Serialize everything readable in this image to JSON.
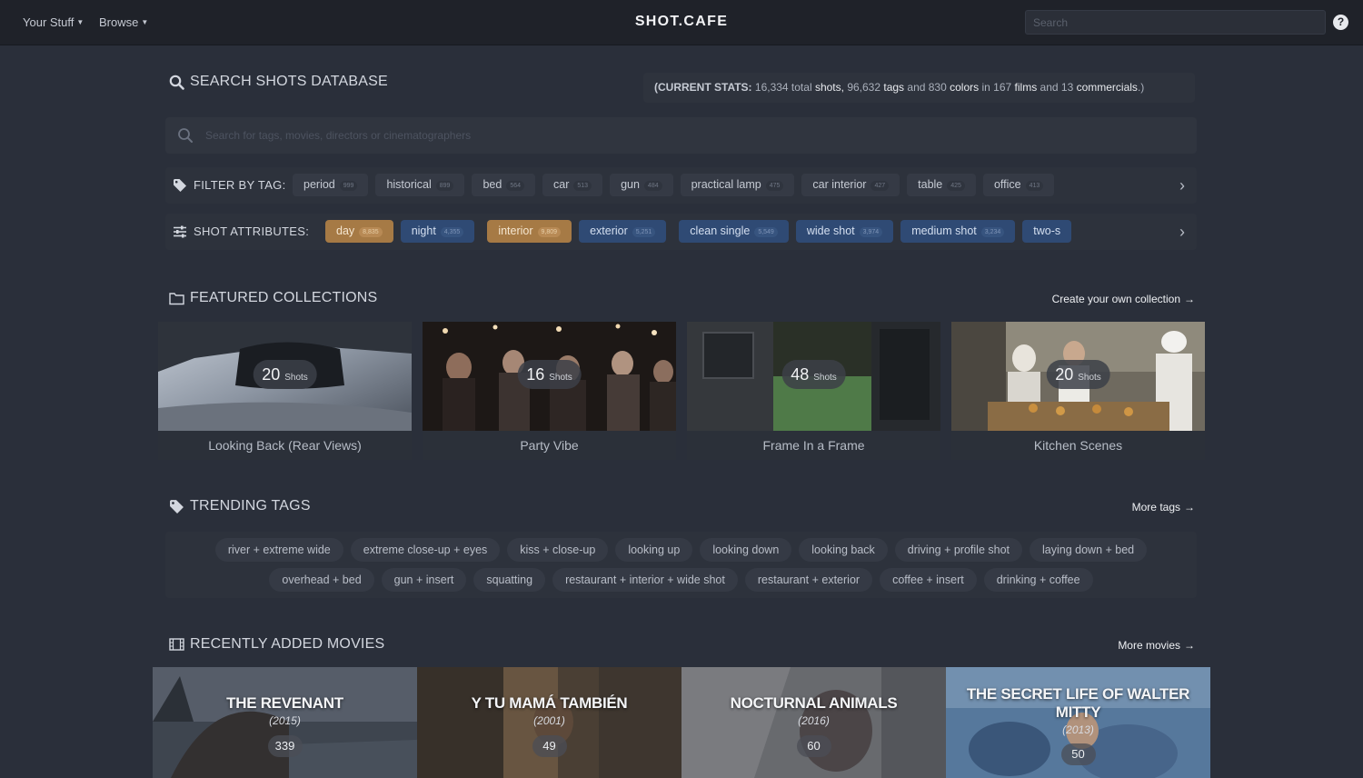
{
  "nav": {
    "your_stuff": "Your Stuff",
    "browse": "Browse",
    "logo": "SHOT.CAFE",
    "search_placeholder": "Search",
    "help": "?"
  },
  "search": {
    "title": "SEARCH SHOTS DATABASE",
    "stats_prefix": "(CURRENT STATS:",
    "stats_shots_n": "16,334 total",
    "stats_shots_w": "shots,",
    "stats_tags_n": "96,632",
    "stats_tags_w": "tags",
    "stats_and1": "and 830",
    "stats_colors_w": "colors",
    "stats_in": "in 167",
    "stats_films_w": "films",
    "stats_and2": "and 13",
    "stats_comm_w": "commercials",
    "stats_suffix": ".)",
    "placeholder": "Search for tags, movies, directors or cinematographers",
    "filter_label": "FILTER BY TAG:",
    "tags": [
      {
        "label": "period",
        "count": "999"
      },
      {
        "label": "historical",
        "count": "899"
      },
      {
        "label": "bed",
        "count": "564"
      },
      {
        "label": "car",
        "count": "513"
      },
      {
        "label": "gun",
        "count": "484"
      },
      {
        "label": "practical lamp",
        "count": "475"
      },
      {
        "label": "car interior",
        "count": "427"
      },
      {
        "label": "table",
        "count": "425"
      },
      {
        "label": "office",
        "count": "413"
      }
    ],
    "attr_label": "SHOT ATTRIBUTES:",
    "attributes": [
      {
        "label": "day",
        "count": "8,835"
      },
      {
        "label": "night",
        "count": "4,355"
      },
      {
        "label": "interior",
        "count": "9,809"
      },
      {
        "label": "exterior",
        "count": "5,251"
      },
      {
        "label": "clean single",
        "count": "5,549"
      },
      {
        "label": "wide shot",
        "count": "3,974"
      },
      {
        "label": "medium shot",
        "count": "3,234"
      },
      {
        "label": "two-s",
        "count": ""
      }
    ]
  },
  "collections": {
    "title": "FEATURED COLLECTIONS",
    "link": "Create your own collection",
    "shots_word": "Shots",
    "items": [
      {
        "name": "Looking Back (Rear Views)",
        "count": "20"
      },
      {
        "name": "Party Vibe",
        "count": "16"
      },
      {
        "name": "Frame In a Frame",
        "count": "48"
      },
      {
        "name": "Kitchen Scenes",
        "count": "20"
      }
    ]
  },
  "trending": {
    "title": "TRENDING TAGS",
    "link": "More tags",
    "row1": [
      "river + extreme wide",
      "extreme close-up + eyes",
      "kiss + close-up",
      "looking up",
      "looking down",
      "looking back",
      "driving + profile shot",
      "laying down + bed"
    ],
    "row2": [
      "overhead + bed",
      "gun + insert",
      "squatting",
      "restaurant + interior + wide shot",
      "restaurant + exterior",
      "coffee + insert",
      "drinking + coffee"
    ]
  },
  "movies": {
    "title": "RECENTLY ADDED MOVIES",
    "link": "More movies",
    "items": [
      {
        "title": "THE REVENANT",
        "year": "(2015)",
        "count": "339"
      },
      {
        "title": "Y TU MAMÁ TAMBIÉN",
        "year": "(2001)",
        "count": "49"
      },
      {
        "title": "NOCTURNAL ANIMALS",
        "year": "(2016)",
        "count": "60"
      },
      {
        "title": "THE SECRET LIFE OF WALTER MITTY",
        "year": "(2013)",
        "count": "50"
      }
    ]
  },
  "icons": [
    "search-icon",
    "tag-icon",
    "sliders-icon",
    "folder-icon",
    "film-icon",
    "chevron-right-icon",
    "arrow-right-icon",
    "help-icon"
  ],
  "colors": {
    "accent_blue": "#2f4a74",
    "accent_orange": "#a67a45",
    "background": "#2a2f3a",
    "topbar": "#1f2229"
  }
}
